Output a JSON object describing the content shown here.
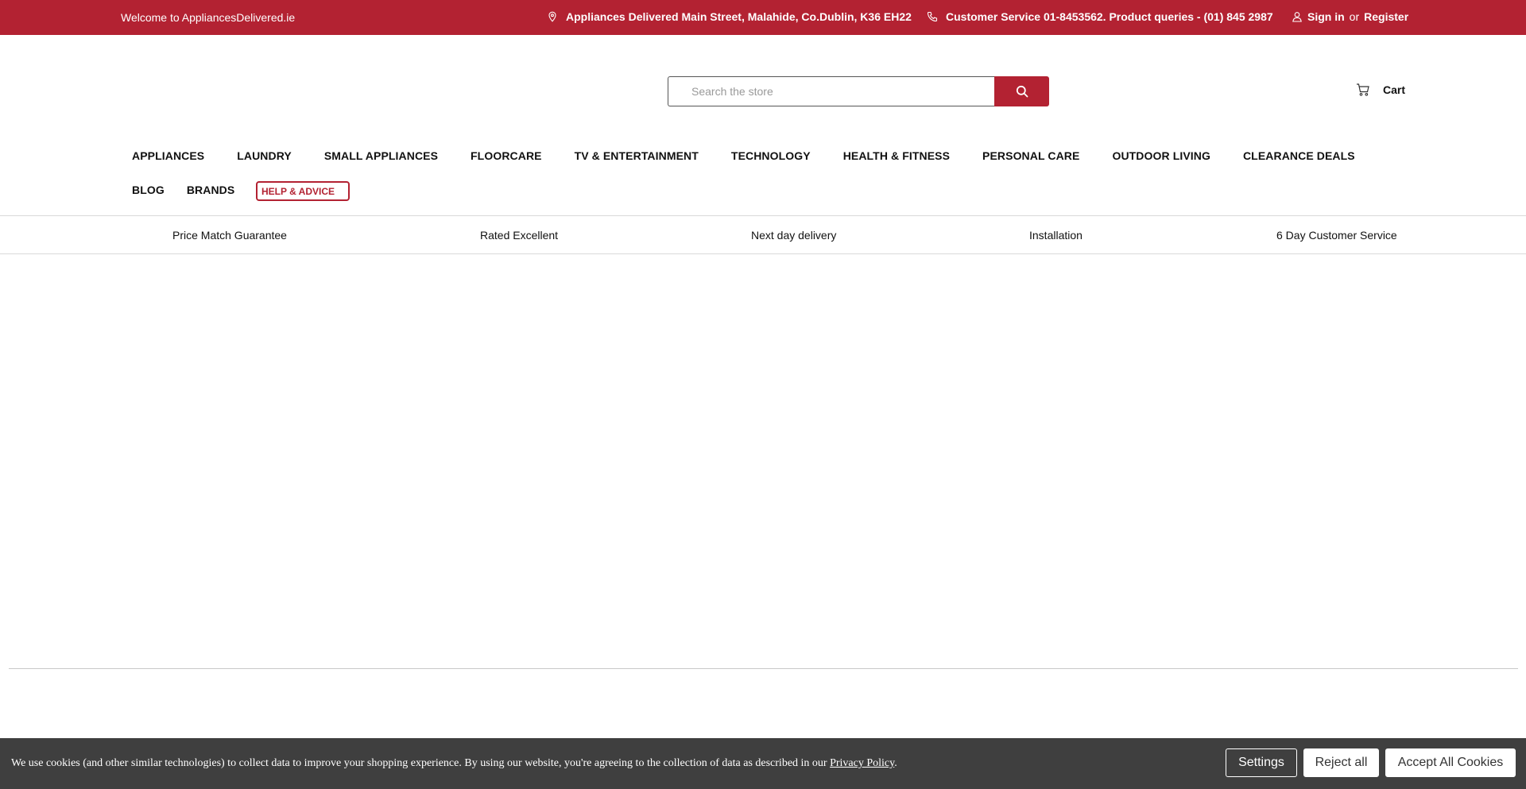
{
  "colors": {
    "brand": "#b32232",
    "cookie_bg": "#3f3f3f"
  },
  "topbar": {
    "welcome": "Welcome to AppliancesDelivered.ie",
    "address_icon": "map-pin-icon",
    "address": "Appliances Delivered Main Street, Malahide, Co.Dublin, K36 EH22",
    "phone_icon": "phone-icon",
    "phone": "Customer Service 01-8453562. Product queries - (01) 845 2987",
    "user_icon": "user-icon",
    "sign_in": "Sign in",
    "or": "or",
    "register": "Register"
  },
  "header": {
    "search_placeholder": "Search the store",
    "search_icon": "search-icon",
    "cart_icon": "cart-icon",
    "cart_label": "Cart"
  },
  "nav": {
    "row1": [
      "APPLIANCES",
      "LAUNDRY",
      "SMALL APPLIANCES",
      "FLOORCARE",
      "TV & ENTERTAINMENT",
      "TECHNOLOGY",
      "HEALTH & FITNESS",
      "PERSONAL CARE",
      "OUTDOOR LIVING",
      "CLEARANCE DEALS"
    ],
    "row2": [
      "BLOG",
      "BRANDS"
    ],
    "help": "HELP & ADVICE"
  },
  "usps": [
    "Price Match Guarantee",
    "Rated Excellent",
    "Next day delivery",
    "Installation",
    "6 Day Customer Service"
  ],
  "cookie": {
    "message": "We use cookies (and other similar technologies) to collect data to improve your shopping experience. By using our website, you're agreeing to the collection of data as described in our ",
    "policy_link": "Privacy Policy",
    "period": ".",
    "settings": "Settings",
    "reject": "Reject all",
    "accept": "Accept All Cookies"
  }
}
